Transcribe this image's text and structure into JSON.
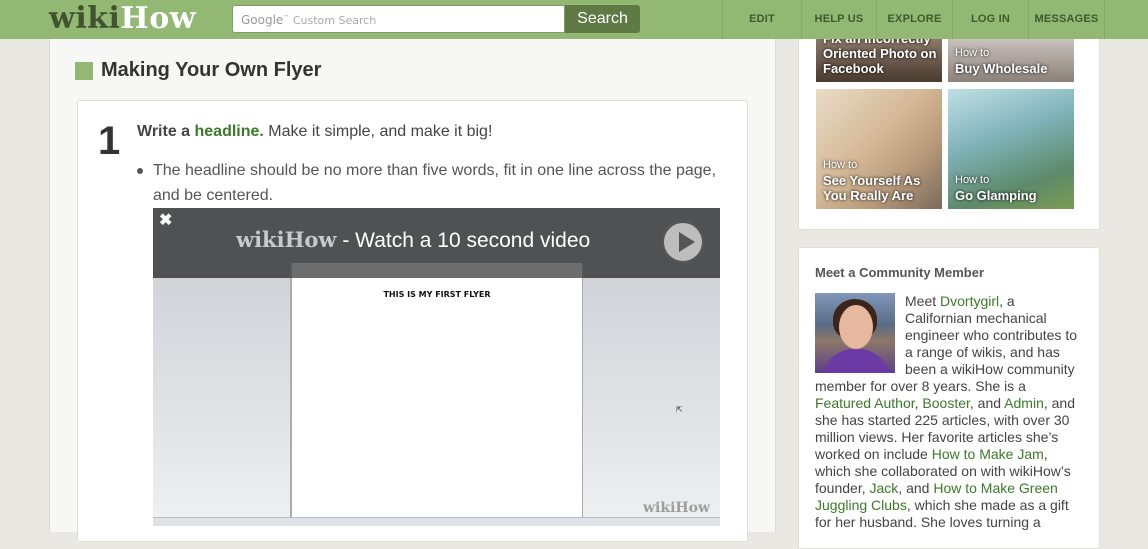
{
  "header": {
    "logo_part1": "wiki",
    "logo_part2": "How",
    "search_placeholder_brand": "Google",
    "search_placeholder_tm": "™",
    "search_placeholder": "Custom Search",
    "search_button": "Search",
    "nav": [
      {
        "label": "EDIT",
        "width": 78
      },
      {
        "label": "HELP US",
        "width": 74
      },
      {
        "label": "EXPLORE",
        "width": 75
      },
      {
        "label": "LOG IN",
        "width": 75
      },
      {
        "label": "MESSAGES",
        "width": 75
      }
    ]
  },
  "article": {
    "section_title": "Making Your Own Flyer",
    "step": {
      "number": "1",
      "lead_start": "Write a ",
      "lead_link": "headline.",
      "lead_rest": " Make it simple, and make it big!",
      "bullet": "The headline should be no more than five words, fit in one line across the page, and be centered."
    },
    "video": {
      "close": "✖",
      "logo": "wikiHow",
      "title_rest": " - Watch a 10 second video",
      "page_text": "THIS IS MY FIRST FLYER",
      "watermark": "wikiHow",
      "cursor": "⇱"
    }
  },
  "sidebar": {
    "related": [
      {
        "howto": "",
        "title": "Fix an Incorrectly Oriented Photo on Facebook",
        "color": "#5b4a3c"
      },
      {
        "howto": "How to",
        "title": "Buy Wholesale",
        "color": "#a59b93"
      },
      {
        "howto": "How to",
        "title": "See Yourself As You Really Are",
        "color": "#c9a78c"
      },
      {
        "howto": "How to",
        "title": "Go Glamping",
        "color": "#7fb2b8"
      }
    ],
    "community": {
      "heading": "Meet a Community Member",
      "t1": "Meet ",
      "name": "Dvortygirl",
      "t2": ", a Californian mechanical engineer who contributes to a range of wikis, and has been a wikiHow community member for over 8 years. She is a ",
      "l1": "Featured Author",
      "t3": ", ",
      "l2": "Booster",
      "t4": ", and ",
      "l3": "Admin",
      "t5": ", and she has started 225 articles, with over 30 million views. Her favorite articles she’s worked on include ",
      "l4": "How to Make Jam",
      "t6": ", which she collaborated on with wikiHow’s founder, ",
      "l5": "Jack",
      "t7": ", and ",
      "l6": "How to Make Green Juggling Clubs",
      "t8": ", which she made as a gift for her husband. She loves turning a"
    }
  }
}
